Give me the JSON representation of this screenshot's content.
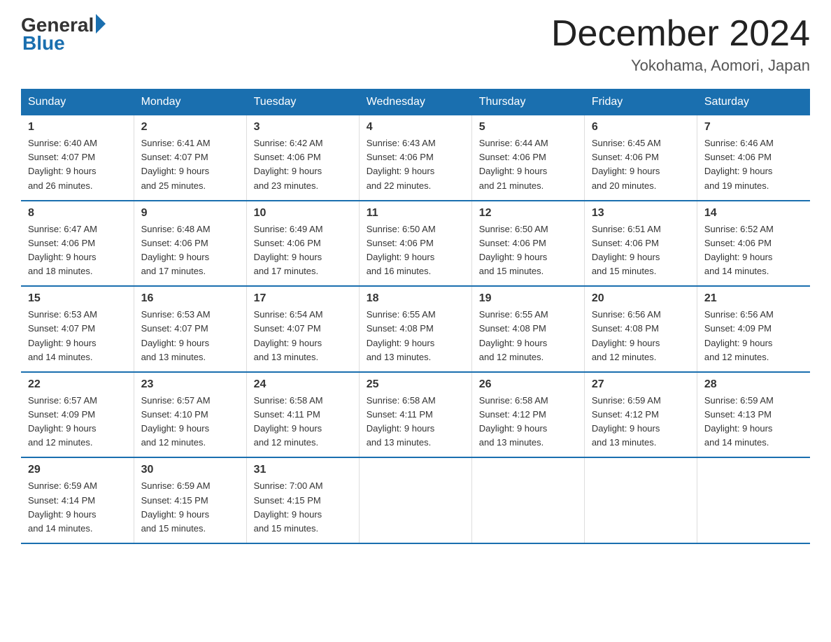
{
  "logo": {
    "general": "General",
    "blue": "Blue"
  },
  "title": "December 2024",
  "location": "Yokohama, Aomori, Japan",
  "days_of_week": [
    "Sunday",
    "Monday",
    "Tuesday",
    "Wednesday",
    "Thursday",
    "Friday",
    "Saturday"
  ],
  "weeks": [
    [
      {
        "day": "1",
        "sunrise": "6:40 AM",
        "sunset": "4:07 PM",
        "daylight": "9 hours and 26 minutes."
      },
      {
        "day": "2",
        "sunrise": "6:41 AM",
        "sunset": "4:07 PM",
        "daylight": "9 hours and 25 minutes."
      },
      {
        "day": "3",
        "sunrise": "6:42 AM",
        "sunset": "4:06 PM",
        "daylight": "9 hours and 23 minutes."
      },
      {
        "day": "4",
        "sunrise": "6:43 AM",
        "sunset": "4:06 PM",
        "daylight": "9 hours and 22 minutes."
      },
      {
        "day": "5",
        "sunrise": "6:44 AM",
        "sunset": "4:06 PM",
        "daylight": "9 hours and 21 minutes."
      },
      {
        "day": "6",
        "sunrise": "6:45 AM",
        "sunset": "4:06 PM",
        "daylight": "9 hours and 20 minutes."
      },
      {
        "day": "7",
        "sunrise": "6:46 AM",
        "sunset": "4:06 PM",
        "daylight": "9 hours and 19 minutes."
      }
    ],
    [
      {
        "day": "8",
        "sunrise": "6:47 AM",
        "sunset": "4:06 PM",
        "daylight": "9 hours and 18 minutes."
      },
      {
        "day": "9",
        "sunrise": "6:48 AM",
        "sunset": "4:06 PM",
        "daylight": "9 hours and 17 minutes."
      },
      {
        "day": "10",
        "sunrise": "6:49 AM",
        "sunset": "4:06 PM",
        "daylight": "9 hours and 17 minutes."
      },
      {
        "day": "11",
        "sunrise": "6:50 AM",
        "sunset": "4:06 PM",
        "daylight": "9 hours and 16 minutes."
      },
      {
        "day": "12",
        "sunrise": "6:50 AM",
        "sunset": "4:06 PM",
        "daylight": "9 hours and 15 minutes."
      },
      {
        "day": "13",
        "sunrise": "6:51 AM",
        "sunset": "4:06 PM",
        "daylight": "9 hours and 15 minutes."
      },
      {
        "day": "14",
        "sunrise": "6:52 AM",
        "sunset": "4:06 PM",
        "daylight": "9 hours and 14 minutes."
      }
    ],
    [
      {
        "day": "15",
        "sunrise": "6:53 AM",
        "sunset": "4:07 PM",
        "daylight": "9 hours and 14 minutes."
      },
      {
        "day": "16",
        "sunrise": "6:53 AM",
        "sunset": "4:07 PM",
        "daylight": "9 hours and 13 minutes."
      },
      {
        "day": "17",
        "sunrise": "6:54 AM",
        "sunset": "4:07 PM",
        "daylight": "9 hours and 13 minutes."
      },
      {
        "day": "18",
        "sunrise": "6:55 AM",
        "sunset": "4:08 PM",
        "daylight": "9 hours and 13 minutes."
      },
      {
        "day": "19",
        "sunrise": "6:55 AM",
        "sunset": "4:08 PM",
        "daylight": "9 hours and 12 minutes."
      },
      {
        "day": "20",
        "sunrise": "6:56 AM",
        "sunset": "4:08 PM",
        "daylight": "9 hours and 12 minutes."
      },
      {
        "day": "21",
        "sunrise": "6:56 AM",
        "sunset": "4:09 PM",
        "daylight": "9 hours and 12 minutes."
      }
    ],
    [
      {
        "day": "22",
        "sunrise": "6:57 AM",
        "sunset": "4:09 PM",
        "daylight": "9 hours and 12 minutes."
      },
      {
        "day": "23",
        "sunrise": "6:57 AM",
        "sunset": "4:10 PM",
        "daylight": "9 hours and 12 minutes."
      },
      {
        "day": "24",
        "sunrise": "6:58 AM",
        "sunset": "4:11 PM",
        "daylight": "9 hours and 12 minutes."
      },
      {
        "day": "25",
        "sunrise": "6:58 AM",
        "sunset": "4:11 PM",
        "daylight": "9 hours and 13 minutes."
      },
      {
        "day": "26",
        "sunrise": "6:58 AM",
        "sunset": "4:12 PM",
        "daylight": "9 hours and 13 minutes."
      },
      {
        "day": "27",
        "sunrise": "6:59 AM",
        "sunset": "4:12 PM",
        "daylight": "9 hours and 13 minutes."
      },
      {
        "day": "28",
        "sunrise": "6:59 AM",
        "sunset": "4:13 PM",
        "daylight": "9 hours and 14 minutes."
      }
    ],
    [
      {
        "day": "29",
        "sunrise": "6:59 AM",
        "sunset": "4:14 PM",
        "daylight": "9 hours and 14 minutes."
      },
      {
        "day": "30",
        "sunrise": "6:59 AM",
        "sunset": "4:15 PM",
        "daylight": "9 hours and 15 minutes."
      },
      {
        "day": "31",
        "sunrise": "7:00 AM",
        "sunset": "4:15 PM",
        "daylight": "9 hours and 15 minutes."
      },
      null,
      null,
      null,
      null
    ]
  ],
  "labels": {
    "sunrise": "Sunrise:",
    "sunset": "Sunset:",
    "daylight": "Daylight:"
  }
}
